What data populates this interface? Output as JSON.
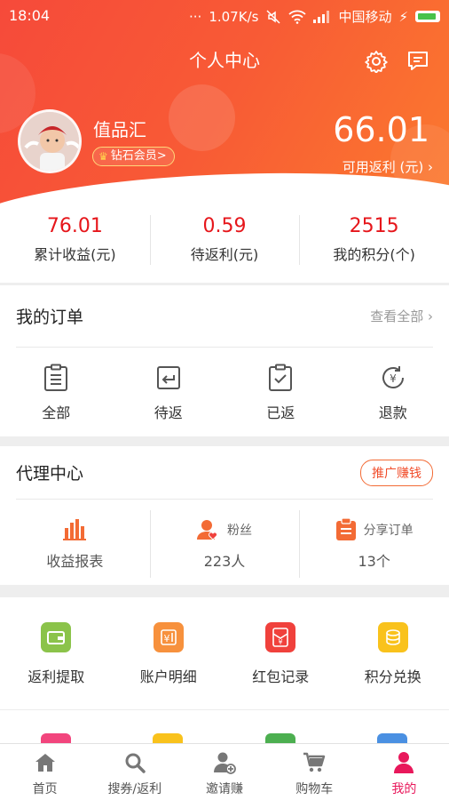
{
  "status": {
    "time": "18:04",
    "speed": "1.07K/s",
    "carrier": "中国移动"
  },
  "header": {
    "title": "个人中心"
  },
  "user": {
    "name": "值品汇",
    "level": "钻石会员>",
    "rebate_amount": "66.01",
    "rebate_label": "可用返利 (元) ›"
  },
  "stats": [
    {
      "value": "76.01",
      "label": "累计收益(元)"
    },
    {
      "value": "0.59",
      "label": "待返利(元)"
    },
    {
      "value": "2515",
      "label": "我的积分(个)"
    }
  ],
  "orders": {
    "title": "我的订单",
    "view_all": "查看全部 ›",
    "items": [
      {
        "label": "全部",
        "icon": "clipboard-list-icon"
      },
      {
        "label": "待返",
        "icon": "return-arrow-icon"
      },
      {
        "label": "已返",
        "icon": "clipboard-check-icon"
      },
      {
        "label": "退款",
        "icon": "yen-refund-icon"
      }
    ]
  },
  "agent": {
    "title": "代理中心",
    "promote": "推广赚钱",
    "report_label": "收益报表",
    "fans_label": "粉丝",
    "fans_value": "223人",
    "share_label": "分享订单",
    "share_value": "13个"
  },
  "functions": [
    {
      "label": "返利提取",
      "color": "#8bc34a",
      "icon": "wallet-icon"
    },
    {
      "label": "账户明细",
      "color": "#f7913d",
      "icon": "account-detail-icon"
    },
    {
      "label": "红包记录",
      "color": "#f0413c",
      "icon": "red-packet-icon"
    },
    {
      "label": "积分兑换",
      "color": "#f9c21c",
      "icon": "coins-icon"
    }
  ],
  "tabs": [
    {
      "label": "首页",
      "icon": "home-icon"
    },
    {
      "label": "搜券/返利",
      "icon": "search-icon"
    },
    {
      "label": "邀请赚",
      "icon": "add-user-icon"
    },
    {
      "label": "购物车",
      "icon": "cart-icon"
    },
    {
      "label": "我的",
      "icon": "profile-icon",
      "active": true
    }
  ],
  "colors": {
    "header_start": "#f64a3a",
    "header_end": "#fb7a2e",
    "accent": "#e6161b",
    "active_tab": "#e8185b"
  }
}
